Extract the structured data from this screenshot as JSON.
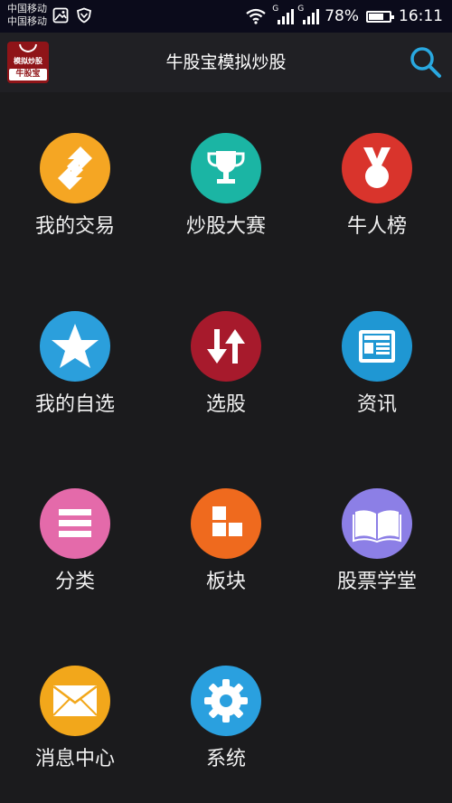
{
  "status_bar": {
    "carrier_1": "中国移动",
    "carrier_2": "中国移动",
    "signal_1_label": "G",
    "signal_2_label": "G",
    "battery_text": "78%",
    "battery_level": 0.78,
    "time": "16:11"
  },
  "app_bar": {
    "title": "牛股宝模拟炒股",
    "logo_text_top": "模拟炒股",
    "logo_text_bottom": "牛股宝",
    "search_icon": "search-icon",
    "accent_color": "#29a8e0"
  },
  "menu": [
    {
      "label": "我的交易",
      "icon": "swap-arrows-icon",
      "color": "#f5a623"
    },
    {
      "label": "炒股大赛",
      "icon": "trophy-icon",
      "color": "#1bb5a4"
    },
    {
      "label": "牛人榜",
      "icon": "medal-icon",
      "color": "#d9342c"
    },
    {
      "label": "我的自选",
      "icon": "star-icon",
      "color": "#2b9fdc"
    },
    {
      "label": "选股",
      "icon": "up-down-arrows-icon",
      "color": "#a71a2c"
    },
    {
      "label": "资讯",
      "icon": "newspaper-icon",
      "color": "#1f97d3"
    },
    {
      "label": "分类",
      "icon": "list-icon",
      "color": "#e46aaa"
    },
    {
      "label": "板块",
      "icon": "blocks-icon",
      "color": "#ef6a1e"
    },
    {
      "label": "股票学堂",
      "icon": "book-icon",
      "color": "#8c7fe6"
    },
    {
      "label": "消息中心",
      "icon": "envelope-icon",
      "color": "#f2a71b"
    },
    {
      "label": "系统",
      "icon": "gear-icon",
      "color": "#2aa0df"
    }
  ]
}
